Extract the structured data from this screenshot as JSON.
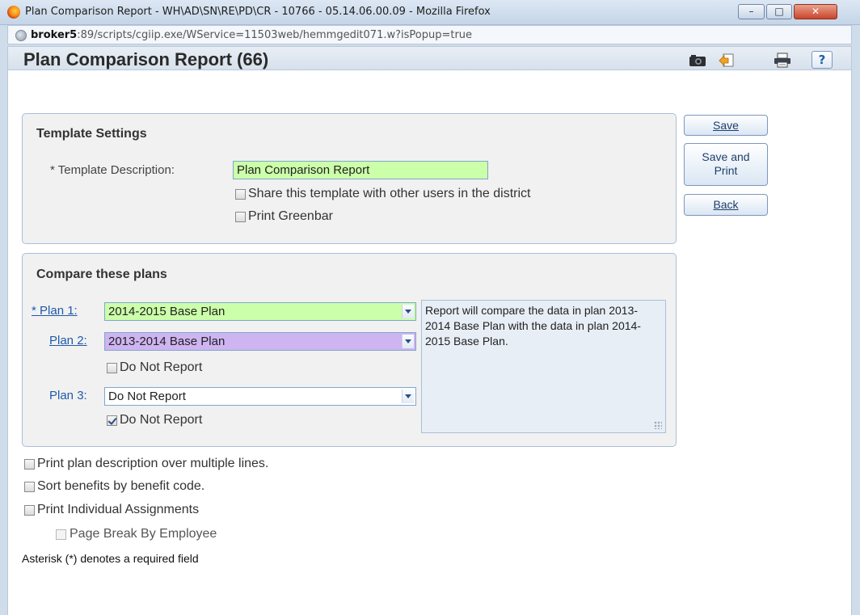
{
  "window": {
    "title": "Plan Comparison Report - WH\\AD\\SN\\RE\\PD\\CR - 10766 - 05.14.06.00.09 - Mozilla Firefox",
    "url_host": "broker5",
    "url_rest": ":89/scripts/cgiip.exe/WService=11503web/hemmgedit071.w?isPopup=true"
  },
  "page": {
    "title": "Plan Comparison Report (66)",
    "help_label": "?"
  },
  "template_settings": {
    "heading": "Template Settings",
    "description_label": "* Template Description:",
    "description_value": "Plan Comparison Report",
    "share_label": "Share this template with other users in the district",
    "share_checked": false,
    "greenbar_label": "Print Greenbar",
    "greenbar_checked": false
  },
  "compare": {
    "heading": "Compare these plans",
    "plan1_star": "* ",
    "plan1_label": "Plan 1:",
    "plan1_value": "2014-2015 Base Plan",
    "plan2_label": "Plan 2:",
    "plan2_value": "2013-2014 Base Plan",
    "plan2_dnr_label": "Do Not Report",
    "plan2_dnr_checked": false,
    "plan3_label": "Plan 3:",
    "plan3_value": "Do Not Report",
    "plan3_dnr_label": "Do Not Report",
    "plan3_dnr_checked": true,
    "summary": "Report will compare the data in plan 2013-2014 Base Plan with the data in plan 2014-2015 Base Plan."
  },
  "options": {
    "multiline_label": "Print plan description over multiple lines.",
    "sort_label": "Sort benefits by benefit code.",
    "assignments_label": "Print Individual Assignments",
    "pagebreak_label": "Page Break By Employee",
    "note": "Asterisk (*) denotes a required field"
  },
  "actions": {
    "save": "Save",
    "save_print_line1": "Save and",
    "save_print_line2": "Print",
    "back": "Back"
  },
  "colors": {
    "required_field": "#ccffaa",
    "plan2_field": "#cfb4f2",
    "link": "#1f5aa9"
  }
}
